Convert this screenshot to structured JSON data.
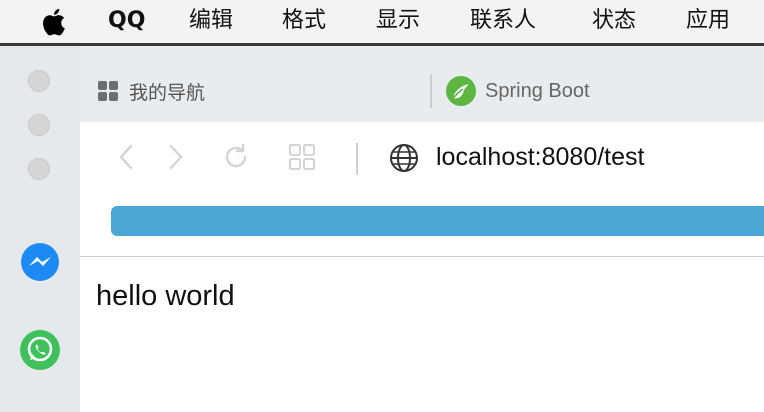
{
  "menubar": {
    "app_name": "QQ",
    "items": [
      "编辑",
      "格式",
      "显示",
      "联系人",
      "状态",
      "应用"
    ]
  },
  "sidebar": {
    "apps": [
      {
        "name": "Messenger",
        "icon": "messenger-icon"
      },
      {
        "name": "WhatsApp",
        "icon": "whatsapp-icon"
      }
    ]
  },
  "tabs": [
    {
      "label": "我的导航",
      "icon": "grid-icon"
    },
    {
      "label": "Spring Boot",
      "icon": "spring-leaf-icon"
    }
  ],
  "toolbar": {
    "url": "localhost:8080/test",
    "progress": 1.0
  },
  "page": {
    "body_text": "hello world"
  },
  "colors": {
    "progress": "#4aa6d4",
    "messenger": "#1e8bf5",
    "whatsapp": "#3ec15a",
    "spring": "#5eb642"
  }
}
